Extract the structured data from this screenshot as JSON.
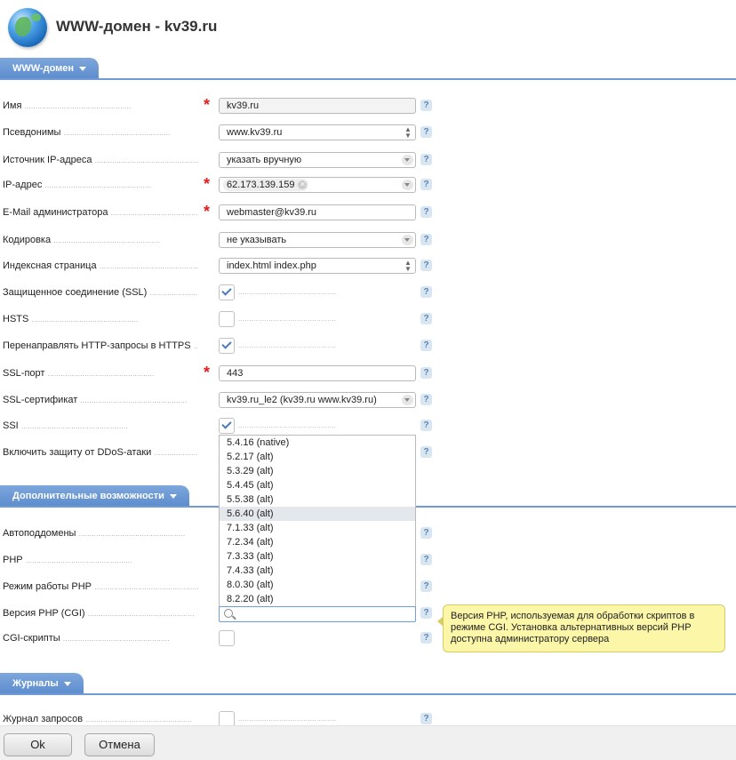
{
  "header": {
    "title": "WWW-домен - kv39.ru"
  },
  "sections": {
    "domain": "WWW-домен",
    "extra": "Дополнительные возможности",
    "logs": "Журналы"
  },
  "fields": {
    "name": {
      "label": "Имя",
      "value": "kv39.ru"
    },
    "aliases": {
      "label": "Псевдонимы",
      "value": "www.kv39.ru"
    },
    "ip_source": {
      "label": "Источник IP-адреса",
      "value": "указать вручную"
    },
    "ip": {
      "label": "IP-адрес",
      "value": "62.173.139.159"
    },
    "email": {
      "label": "E-Mail администратора",
      "value": "webmaster@kv39.ru"
    },
    "charset": {
      "label": "Кодировка",
      "value": "не указывать"
    },
    "index": {
      "label": "Индексная страница",
      "value": "index.html index.php"
    },
    "ssl": {
      "label": "Защищенное соединение (SSL)",
      "checked": true
    },
    "hsts": {
      "label": "HSTS",
      "checked": false
    },
    "redirect_https": {
      "label": "Перенаправлять HTTP-запросы в HTTPS",
      "checked": true
    },
    "ssl_port": {
      "label": "SSL-порт",
      "value": "443"
    },
    "ssl_cert": {
      "label": "SSL-сертификат",
      "value": "kv39.ru_le2 (kv39.ru www.kv39.ru)"
    },
    "ssi": {
      "label": "SSI",
      "checked": true
    },
    "ddos": {
      "label": "Включить защиту от DDoS-атаки"
    },
    "autosub": {
      "label": "Автоподдомены"
    },
    "php": {
      "label": "PHP"
    },
    "php_mode": {
      "label": "Режим работы PHP"
    },
    "php_version": {
      "label": "Версия PHP (CGI)"
    },
    "cgi": {
      "label": "CGI-скрипты",
      "checked": false
    },
    "access_log": {
      "label": "Журнал запросов",
      "checked": false
    }
  },
  "php_versions": [
    "5.4.16 (native)",
    "5.2.17 (alt)",
    "5.3.29 (alt)",
    "5.4.45 (alt)",
    "5.5.38 (alt)",
    "5.6.40 (alt)",
    "7.1.33 (alt)",
    "7.2.34 (alt)",
    "7.3.33 (alt)",
    "7.4.33 (alt)",
    "8.0.30 (alt)",
    "8.2.20 (alt)"
  ],
  "php_versions_highlighted": "5.6.40 (alt)",
  "tooltip": "Версия PHP, используемая для обработки скриптов в режиме CGI. Установка альтернативных версий PHP доступна администратору сервера",
  "help_glyph": "?",
  "buttons": {
    "ok": "Ok",
    "cancel": "Отмена"
  }
}
